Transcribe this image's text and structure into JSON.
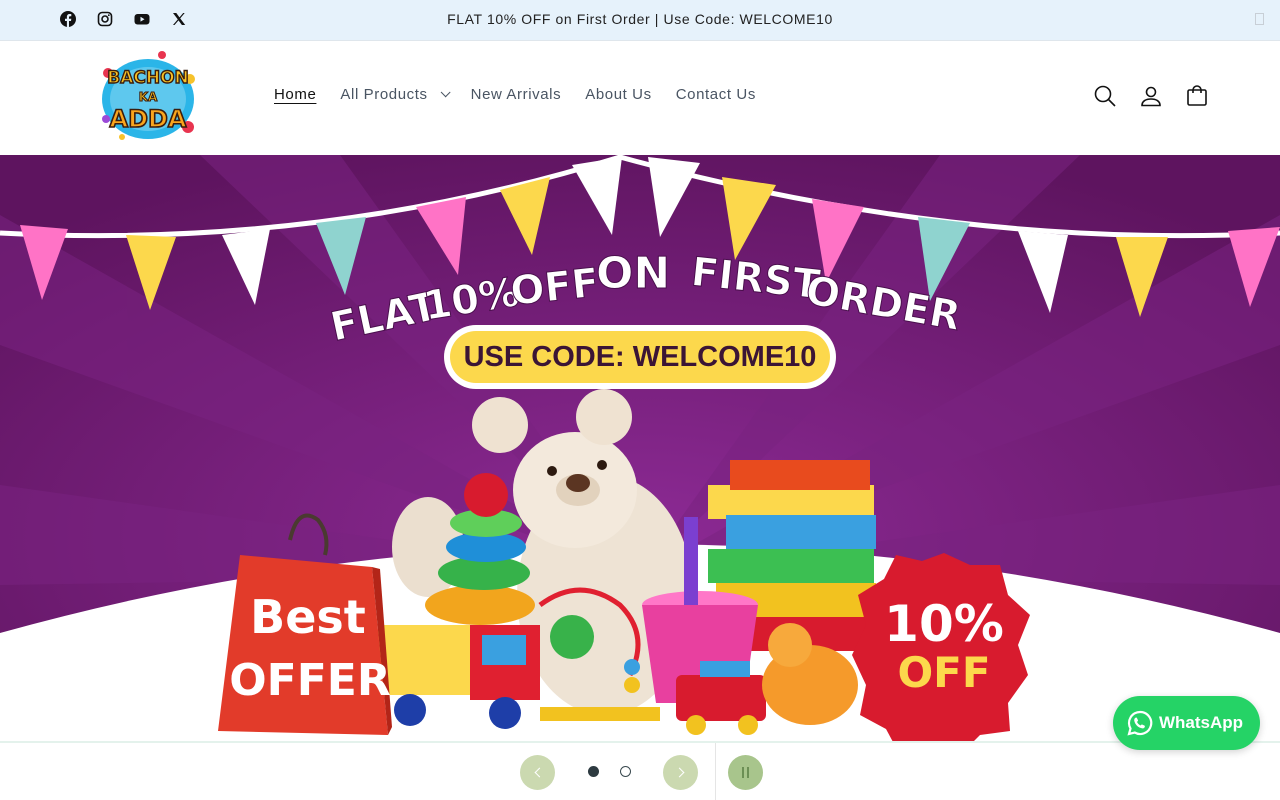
{
  "announcement": {
    "text": "FLAT 10% OFF on First Order | Use Code: WELCOME10",
    "social_icons": [
      "facebook-icon",
      "instagram-icon",
      "youtube-icon",
      "x-icon"
    ]
  },
  "header": {
    "logo_text": [
      "BACHON",
      "KA",
      "ADDA"
    ],
    "nav": [
      {
        "label": "Home",
        "active": true
      },
      {
        "label": "All Products",
        "dropdown": true
      },
      {
        "label": "New Arrivals"
      },
      {
        "label": "About Us"
      },
      {
        "label": "Contact Us"
      }
    ],
    "icons": [
      "search-icon",
      "account-icon",
      "cart-icon"
    ]
  },
  "hero": {
    "headline_words": [
      "FLAT",
      "10%",
      "OFF",
      "ON",
      "FIRST",
      "ORDER"
    ],
    "code_label": "USE CODE: WELCOME10",
    "bag_text": [
      "Best",
      "OFFER"
    ],
    "badge_text": [
      "10%",
      "OFF"
    ],
    "colors": {
      "purple": "#6d1a72",
      "yellow": "#fcd84c",
      "red": "#d81b2e",
      "pink": "#ff73c6",
      "teal": "#8fd3cf"
    }
  },
  "slider": {
    "slide_count": 2,
    "active_slide": 1,
    "icons": [
      "previous-slide-icon",
      "next-slide-icon",
      "pause-icon"
    ]
  },
  "whatsapp": {
    "label": "WhatsApp",
    "color": "#25d366"
  }
}
